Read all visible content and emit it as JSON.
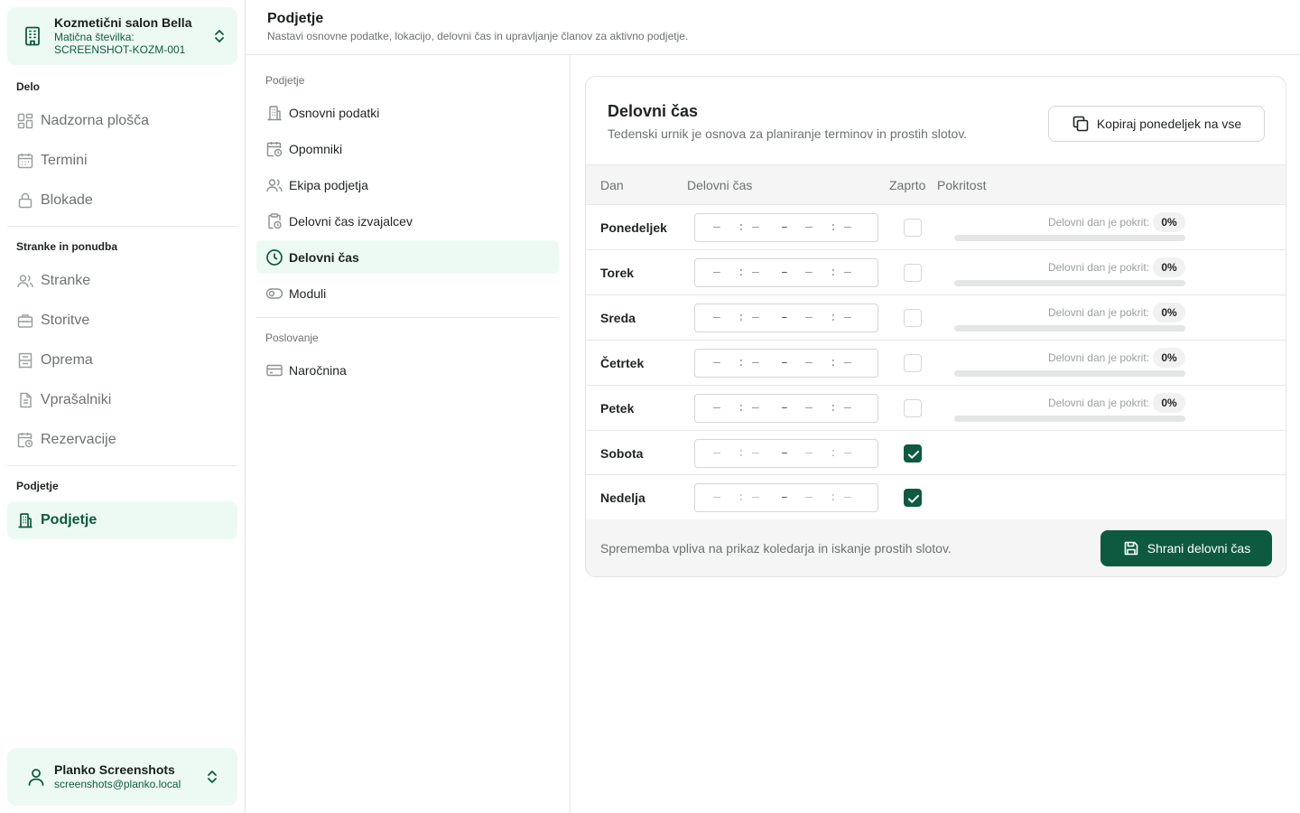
{
  "org": {
    "name": "Kozmetični salon Bella",
    "reg_label": "Matična številka:",
    "reg_number": "SCREENSHOT-KOZM-001"
  },
  "sidebar": {
    "sections": [
      {
        "label": "Delo",
        "items": [
          {
            "label": "Nadzorna plošča",
            "icon": "dashboard-icon"
          },
          {
            "label": "Termini",
            "icon": "calendar-icon"
          },
          {
            "label": "Blokade",
            "icon": "lock-icon"
          }
        ]
      },
      {
        "label": "Stranke in ponudba",
        "items": [
          {
            "label": "Stranke",
            "icon": "users-icon"
          },
          {
            "label": "Storitve",
            "icon": "briefcase-icon"
          },
          {
            "label": "Oprema",
            "icon": "equipment-icon"
          },
          {
            "label": "Vprašalniki",
            "icon": "document-icon"
          },
          {
            "label": "Rezervacije",
            "icon": "calendar-clock-icon"
          }
        ]
      },
      {
        "label": "Podjetje",
        "items": [
          {
            "label": "Podjetje",
            "icon": "building-icon",
            "active": true
          }
        ]
      }
    ]
  },
  "user": {
    "name": "Planko Screenshots",
    "email": "screenshots@planko.local"
  },
  "header": {
    "title": "Podjetje",
    "subtitle": "Nastavi osnovne podatke, lokacijo, delovni čas in upravljanje članov za aktivno podjetje."
  },
  "settings_nav": {
    "group1_label": "Podjetje",
    "group1_items": [
      {
        "label": "Osnovni podatki",
        "icon": "building-icon"
      },
      {
        "label": "Opomniki",
        "icon": "calendar-clock-icon"
      },
      {
        "label": "Ekipa podjetja",
        "icon": "users-icon"
      },
      {
        "label": "Delovni čas izvajalcev",
        "icon": "clipboard-clock-icon"
      },
      {
        "label": "Delovni čas",
        "icon": "clock-icon",
        "active": true
      },
      {
        "label": "Moduli",
        "icon": "toggle-icon"
      }
    ],
    "group2_label": "Poslovanje",
    "group2_items": [
      {
        "label": "Naročnina",
        "icon": "credit-card-icon"
      }
    ]
  },
  "card": {
    "title": "Delovni čas",
    "subtitle": "Tedenski urnik je osnova za planiranje terminov in prostih slotov.",
    "copy_button": "Kopiraj ponedeljek na vse",
    "columns": {
      "day": "Dan",
      "hours": "Delovni čas",
      "closed": "Zaprto",
      "coverage": "Pokritost"
    },
    "time_placeholder": {
      "dash": "—",
      "colon": ":",
      "range": "–"
    },
    "coverage_label": "Delovni dan je pokrit:",
    "days": [
      {
        "name": "Ponedeljek",
        "closed": false,
        "coverage": "0%"
      },
      {
        "name": "Torek",
        "closed": false,
        "coverage": "0%"
      },
      {
        "name": "Sreda",
        "closed": false,
        "coverage": "0%"
      },
      {
        "name": "Četrtek",
        "closed": false,
        "coverage": "0%"
      },
      {
        "name": "Petek",
        "closed": false,
        "coverage": "0%"
      },
      {
        "name": "Sobota",
        "closed": true
      },
      {
        "name": "Nedelja",
        "closed": true
      }
    ],
    "footer_text": "Sprememba vpliva na prikaz koledarja in iskanje prostih slotov.",
    "save_button": "Shrani delovni čas"
  },
  "colors": {
    "accent": "#0d5a41",
    "accent_bg": "#edfaf3"
  }
}
